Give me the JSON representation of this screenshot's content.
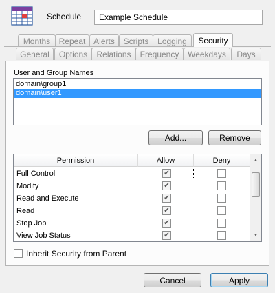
{
  "header": {
    "icon": "calendar-grid-icon",
    "label": "Schedule",
    "name_value": "Example Schedule"
  },
  "tabs_row1": [
    "Months",
    "Repeat",
    "Alerts",
    "Scripts",
    "Logging",
    "Security"
  ],
  "tabs_row2": [
    "General",
    "Options",
    "Relations",
    "Frequency",
    "Weekdays",
    "Days"
  ],
  "active_tab": "Security",
  "users": {
    "label": "User and Group Names",
    "items": [
      {
        "name": "domain\\group1",
        "selected": false
      },
      {
        "name": "domain\\user1",
        "selected": true
      }
    ],
    "add_label": "Add...",
    "remove_label": "Remove"
  },
  "permissions": {
    "columns": [
      "Permission",
      "Allow",
      "Deny"
    ],
    "rows": [
      {
        "name": "Full Control",
        "allow": true,
        "deny": false
      },
      {
        "name": "Modify",
        "allow": true,
        "deny": false
      },
      {
        "name": "Read and Execute",
        "allow": true,
        "deny": false
      },
      {
        "name": "Read",
        "allow": true,
        "deny": false
      },
      {
        "name": "Stop Job",
        "allow": true,
        "deny": false
      },
      {
        "name": "View Job Status",
        "allow": true,
        "deny": false
      }
    ]
  },
  "inherit": {
    "label": "Inherit Security from Parent",
    "checked": false
  },
  "footer": {
    "cancel_label": "Cancel",
    "apply_label": "Apply"
  }
}
